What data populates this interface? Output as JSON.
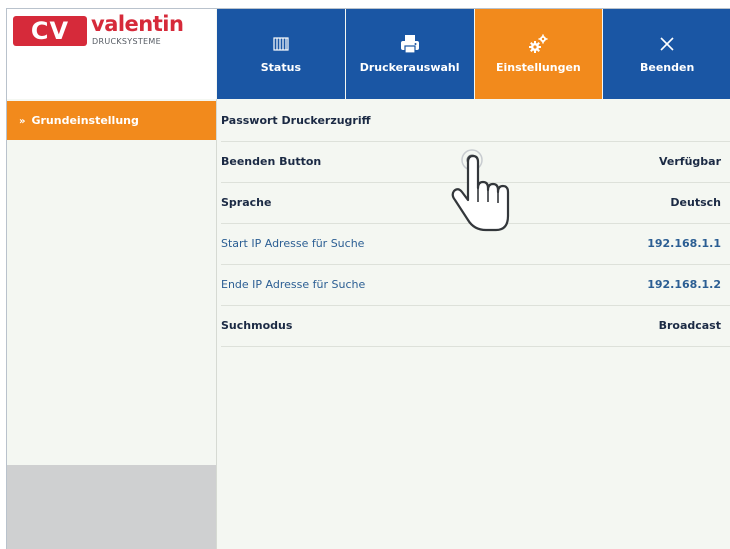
{
  "logo": {
    "mark": "CV",
    "brand": "valentin",
    "subtitle": "DRUCKSYSTEME"
  },
  "nav": {
    "tabs": [
      {
        "label": "Status",
        "icon": "status-grid-icon",
        "active": false
      },
      {
        "label": "Druckerauswahl",
        "icon": "printer-icon",
        "active": false
      },
      {
        "label": "Einstellungen",
        "icon": "gears-icon",
        "active": true
      },
      {
        "label": "Beenden",
        "icon": "close-x-icon",
        "active": false
      }
    ]
  },
  "sidebar": {
    "items": [
      {
        "label": "Grundeinstellung",
        "active": true
      }
    ]
  },
  "settings": {
    "rows": [
      {
        "label": "Passwort Druckerzugriff",
        "value": ""
      },
      {
        "label": "Beenden Button",
        "value": "Verfügbar"
      },
      {
        "label": "Sprache",
        "value": "Deutsch"
      },
      {
        "label": "Start IP Adresse für Suche",
        "value": "192.168.1.1"
      },
      {
        "label": "Ende IP Adresse für Suche",
        "value": "192.168.1.2"
      },
      {
        "label": "Suchmodus",
        "value": "Broadcast"
      }
    ]
  },
  "colors": {
    "primary": "#1a56a4",
    "accent": "#f28a1c",
    "brand_red": "#d62a3a",
    "background": "#f4f7f2"
  },
  "cursor": {
    "icon": "hand-pointer-icon"
  }
}
